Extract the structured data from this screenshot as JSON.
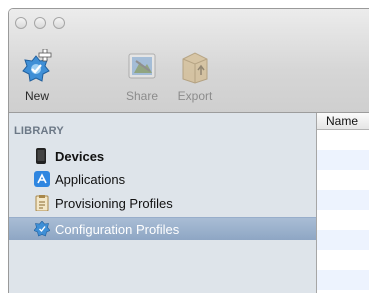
{
  "toolbar": {
    "new_label": "New",
    "share_label": "Share",
    "export_label": "Export"
  },
  "sidebar": {
    "header": "LIBRARY",
    "items": [
      {
        "label": "Devices",
        "icon": "device-icon",
        "bold": true
      },
      {
        "label": "Applications",
        "icon": "app-store-icon"
      },
      {
        "label": "Provisioning Profiles",
        "icon": "provisioning-profile-icon"
      },
      {
        "label": "Configuration Profiles",
        "icon": "configuration-profile-icon",
        "selected": true
      }
    ]
  },
  "table": {
    "columns": [
      "Name"
    ]
  },
  "colors": {
    "selection": "#8ea6c4",
    "sidebar_bg": "#dee4ea",
    "row_alt": "#edf3fe"
  }
}
